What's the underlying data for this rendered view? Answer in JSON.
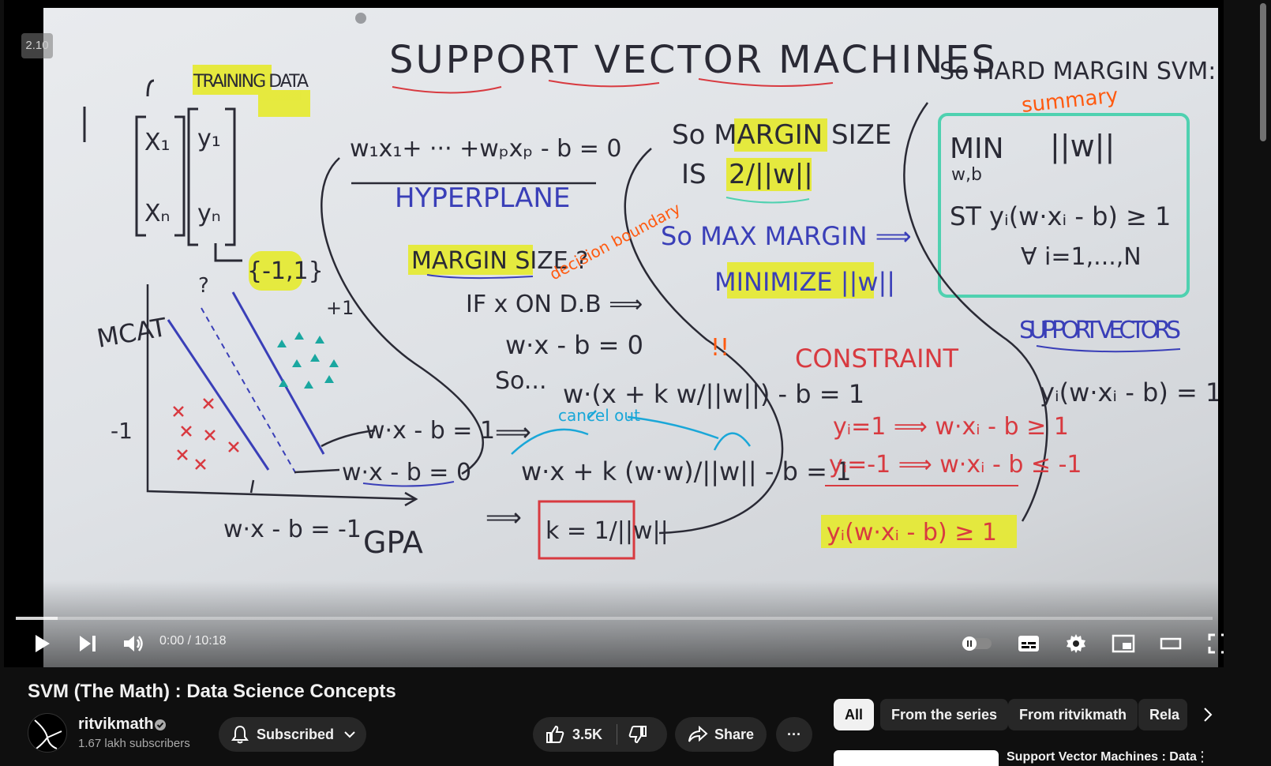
{
  "player": {
    "speed_label": "2.10",
    "current_time": "0:00",
    "duration": "10:18",
    "time_display": "0:00 / 10:18",
    "progress_fraction": 0.035,
    "icons": [
      "play-icon",
      "next-icon",
      "volume-icon",
      "autoplay-toggle-icon",
      "subtitles-icon",
      "settings-icon",
      "miniplayer-icon",
      "theater-mode-icon",
      "fullscreen-icon"
    ]
  },
  "board": {
    "title": "SUPPORT VECTOR MACHINES",
    "training_data": "TRAINING DATA",
    "x1": "X₁",
    "xN": "Xₙ",
    "y1": "y₁",
    "yN": "yₙ",
    "label_set": "{-1,1}",
    "hyperplane_eq": "w₁x₁+ ··· +wₚxₚ - b = 0",
    "hyperplane": "HYPERPLANE",
    "margin_size_q": "MARGIN SIZE ?",
    "decision_boundary": "decision boundary",
    "if_on_db": "IF x ON D.B ⟹",
    "wx_b_0": "w·x - b = 0",
    "so_dots": "So...",
    "subst_eq": "w·(x + k w/||w||) - b = 1",
    "cancel_out": "cancel out",
    "expand_eq": "w·x + k (w·w)/||w|| - b = 1",
    "k_result": "k = 1/||w||",
    "arrow": "⟹",
    "bang": "!!",
    "plus1_line": "w·x - b = 1",
    "zero_line": "w·x - b = 0",
    "minus1_line": "w·x - b = -1",
    "mcat": "MCAT",
    "gpa": "GPA",
    "plus1": "+1",
    "minus1": "-1",
    "margin_q": "?",
    "so_margin_size": "So MARGIN SIZE",
    "is": "IS",
    "two_over_w": "2/||w||",
    "so_max_margin": "So MAX MARGIN ⟹",
    "minimize": "MINIMIZE ||w||",
    "constraint": "CONSTRAINT",
    "c1": "yᵢ=1 ⟹ w·xᵢ - b ≥ 1",
    "c2": "yᵢ=-1 ⟹ w·xᵢ - b ≤ -1",
    "c3": "yᵢ(w·xᵢ - b) ≥ 1",
    "so_hard_margin": "So HARD MARGIN SVM:",
    "summary": "summary",
    "min": "MIN",
    "wb": "w,b",
    "norm_w": "||w||",
    "st": "ST yᵢ(w·xᵢ - b) ≥ 1",
    "forall": "∀ i=1,...,N",
    "support_vectors": "SUPPORT VECTORS",
    "sv_eq": "yᵢ(w·xᵢ - b) = 1"
  },
  "video": {
    "title": "SVM (The Math) : Data Science Concepts"
  },
  "channel": {
    "name": "ritvikmath",
    "subscribers": "1.67 lakh subscribers",
    "subscribe_label": "Subscribed"
  },
  "actions": {
    "like_count": "3.5K",
    "share_label": "Share",
    "more_label": "···"
  },
  "chips": [
    "All",
    "From the series",
    "From ritvikmath",
    "Rela"
  ],
  "recommendation": {
    "title": "Support Vector Machines : Data"
  },
  "colors": {
    "background": "#0f0f0f",
    "pill": "#272727",
    "marker_black": "#2a2a35",
    "marker_blue": "#3a3fb8",
    "marker_red": "#d83a40",
    "marker_orange": "#ff5a10",
    "marker_cyan": "#1aa7d8",
    "marker_teal": "#4fd1b0",
    "highlight": "#e8ec2a"
  }
}
